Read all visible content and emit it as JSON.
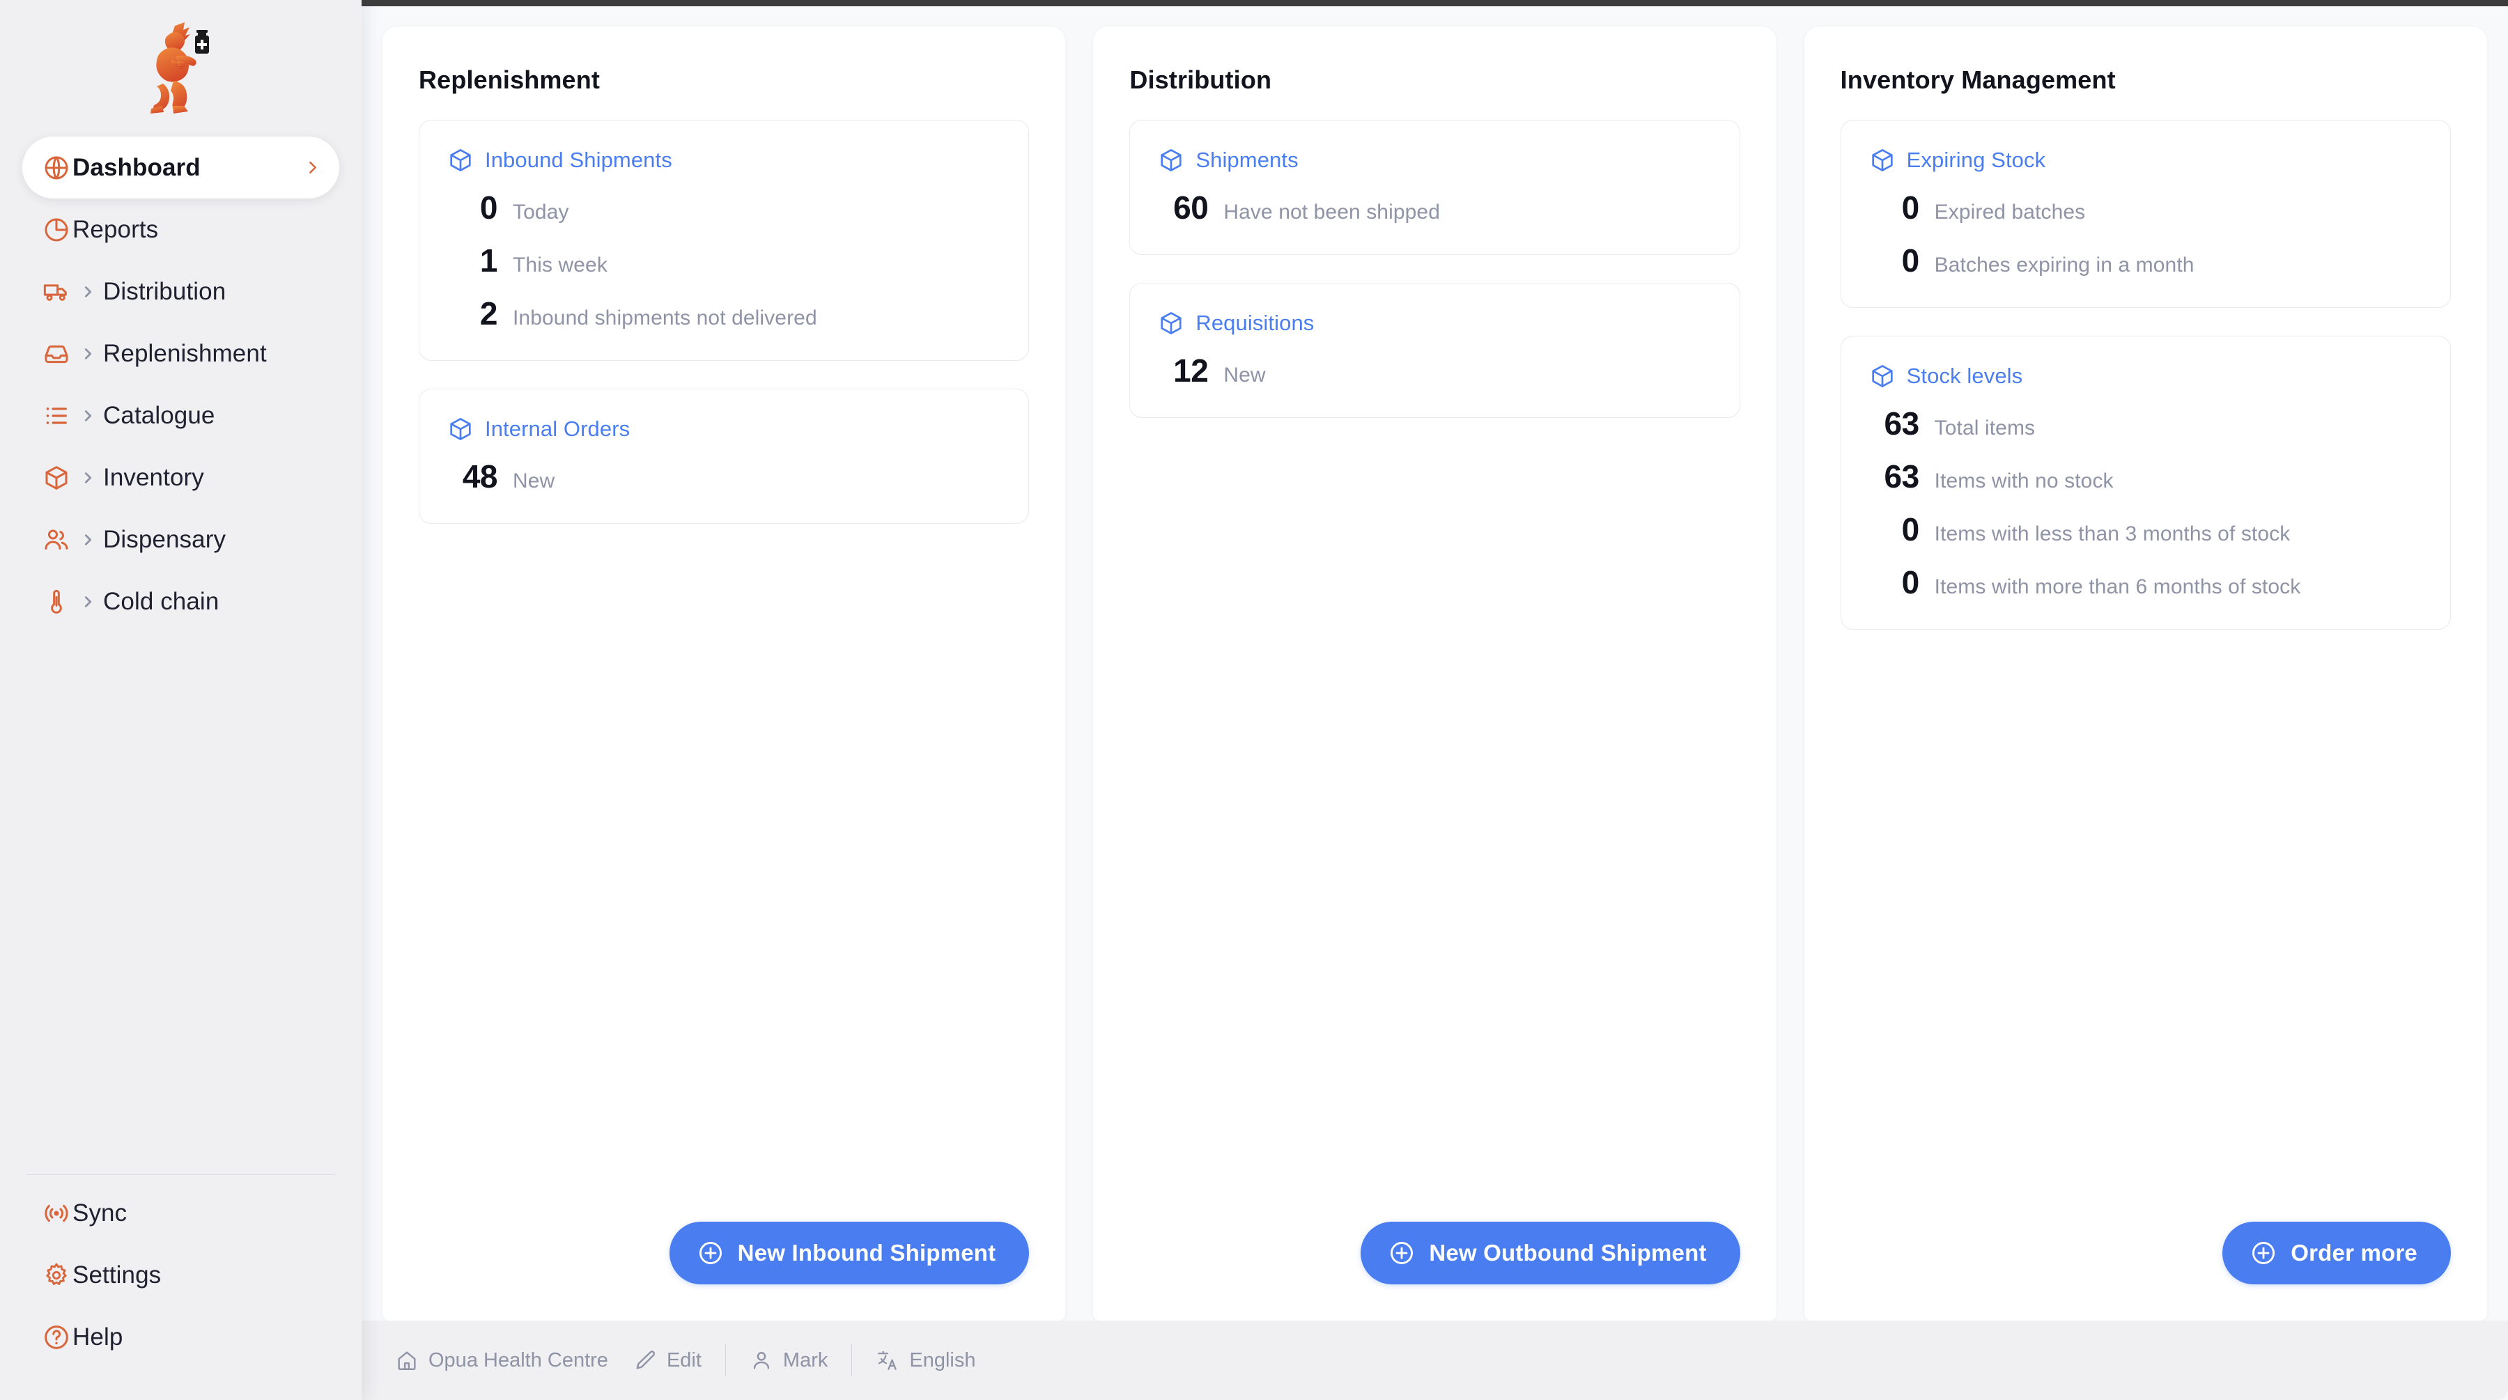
{
  "sidebar": {
    "logo_name": "msupply-running-man-logo",
    "accent_color": "#d9653b",
    "items": [
      {
        "label": "Dashboard",
        "icon": "globe-icon",
        "active": true,
        "expandable": false
      },
      {
        "label": "Reports",
        "icon": "pie-chart-icon",
        "active": false,
        "expandable": false
      },
      {
        "label": "Distribution",
        "icon": "truck-icon",
        "active": false,
        "expandable": true
      },
      {
        "label": "Replenishment",
        "icon": "inbox-tray-icon",
        "active": false,
        "expandable": true
      },
      {
        "label": "Catalogue",
        "icon": "list-icon",
        "active": false,
        "expandable": true
      },
      {
        "label": "Inventory",
        "icon": "box-icon",
        "active": false,
        "expandable": true
      },
      {
        "label": "Dispensary",
        "icon": "people-icon",
        "active": false,
        "expandable": true
      },
      {
        "label": "Cold chain",
        "icon": "thermometer-icon",
        "active": false,
        "expandable": true
      }
    ],
    "bottom_items": [
      {
        "label": "Sync",
        "icon": "radio-waves-icon"
      },
      {
        "label": "Settings",
        "icon": "gear-icon"
      },
      {
        "label": "Help",
        "icon": "question-circle-icon"
      }
    ]
  },
  "theme": {
    "link_blue": "#4a7ef0",
    "button_blue": "#4a7ef0",
    "accent_orange": "#d9653b",
    "muted_text": "#8f93a6"
  },
  "columns": [
    {
      "title": "Replenishment",
      "widgets": [
        {
          "link": "Inbound Shipments",
          "icon": "box-icon",
          "stats": [
            {
              "value": "0",
              "label": "Today"
            },
            {
              "value": "1",
              "label": "This week"
            },
            {
              "value": "2",
              "label": "Inbound shipments not delivered"
            }
          ]
        },
        {
          "link": "Internal Orders",
          "icon": "box-icon",
          "stats": [
            {
              "value": "48",
              "label": "New"
            }
          ]
        }
      ],
      "action": {
        "label": "New Inbound Shipment",
        "icon": "plus-circle-icon"
      }
    },
    {
      "title": "Distribution",
      "widgets": [
        {
          "link": "Shipments",
          "icon": "box-icon",
          "stats": [
            {
              "value": "60",
              "label": "Have not been shipped"
            }
          ]
        },
        {
          "link": "Requisitions",
          "icon": "box-icon",
          "stats": [
            {
              "value": "12",
              "label": "New"
            }
          ]
        }
      ],
      "action": {
        "label": "New Outbound Shipment",
        "icon": "plus-circle-icon"
      }
    },
    {
      "title": "Inventory Management",
      "widgets": [
        {
          "link": "Expiring Stock",
          "icon": "box-icon",
          "stats": [
            {
              "value": "0",
              "label": "Expired batches"
            },
            {
              "value": "0",
              "label": "Batches expiring in a month"
            }
          ]
        },
        {
          "link": "Stock levels",
          "icon": "box-icon",
          "stats": [
            {
              "value": "63",
              "label": "Total items"
            },
            {
              "value": "63",
              "label": "Items with no stock"
            },
            {
              "value": "0",
              "label": "Items with less than 3 months of stock"
            },
            {
              "value": "0",
              "label": "Items with more than 6 months of stock"
            }
          ]
        }
      ],
      "action": {
        "label": "Order more",
        "icon": "plus-circle-icon"
      }
    }
  ],
  "footer": {
    "store": {
      "label": "Opua Health Centre",
      "icon": "home-icon"
    },
    "edit": {
      "label": "Edit",
      "icon": "pencil-icon"
    },
    "user": {
      "label": "Mark",
      "icon": "person-icon"
    },
    "language": {
      "label": "English",
      "icon": "translate-icon"
    }
  }
}
